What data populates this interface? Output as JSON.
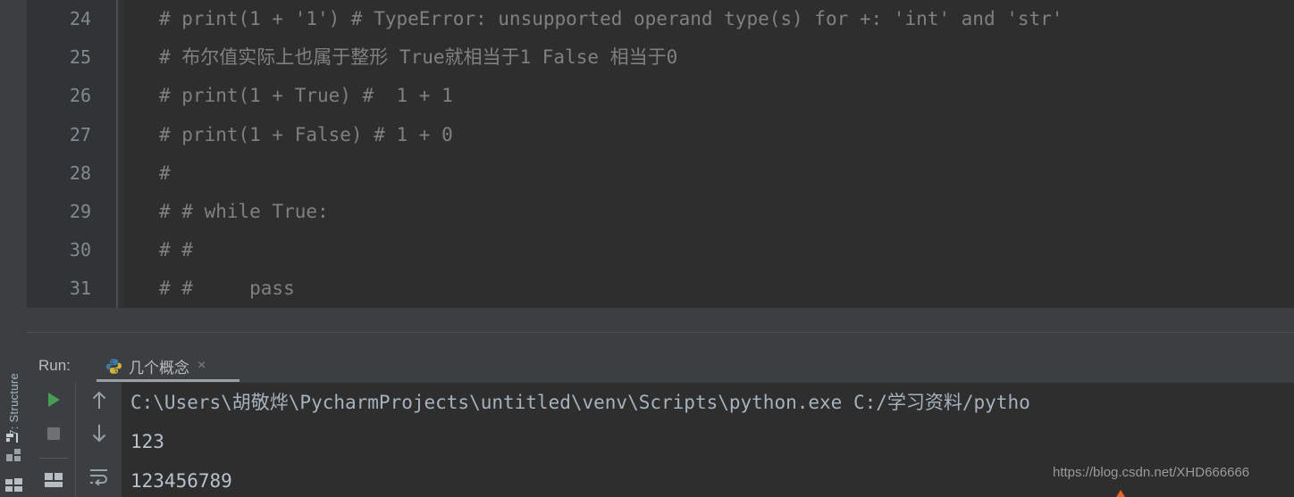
{
  "colors": {
    "editor_bg": "#2e2e2e",
    "gutter_bg": "#313335",
    "panel_bg": "#3c3f41",
    "comment_text": "#808080",
    "line_number": "#808b91",
    "console_text": "#b7c2cc",
    "run_green": "#499c54",
    "accent_underline": "#9ba0a4"
  },
  "tool_strip": {
    "structure_label_prefix": "7",
    "structure_label": "7: Structure",
    "icons": {
      "pin": "pin-icon",
      "structure": "structure-icon",
      "windows": "windows-icon"
    }
  },
  "editor": {
    "fold_marker": "fold-collapse-icon",
    "lines": [
      {
        "number": "24",
        "text": "# print(1 + '1') # TypeError: unsupported operand type(s) for +: 'int' and 'str'"
      },
      {
        "number": "25",
        "text": "# 布尔值实际上也属于整形 True就相当于1 False 相当于0"
      },
      {
        "number": "26",
        "text": "# print(1 + True) #  1 + 1"
      },
      {
        "number": "27",
        "text": "# print(1 + False) # 1 + 0"
      },
      {
        "number": "28",
        "text": "#"
      },
      {
        "number": "29",
        "text": "# # while True:"
      },
      {
        "number": "30",
        "text": "# #"
      },
      {
        "number": "31",
        "text": "# #     pass"
      }
    ]
  },
  "run_panel": {
    "label": "Run:",
    "tab": {
      "title": "几个概念",
      "close": "×",
      "icon": "python-icon"
    },
    "toolbar": {
      "run_button": "run-icon",
      "stop_button": "stop-icon",
      "layout_button": "layout-icon",
      "up_button": "arrow-up-icon",
      "down_button": "arrow-down-icon",
      "wrap_button": "soft-wrap-icon"
    },
    "console_lines": [
      {
        "kind": "cmd",
        "text": "C:\\Users\\胡敬烨\\PycharmProjects\\untitled\\venv\\Scripts\\python.exe C:/学习资料/pytho"
      },
      {
        "kind": "out",
        "text": "123"
      },
      {
        "kind": "out",
        "text": "123456789"
      }
    ]
  },
  "watermark": {
    "url": "https://blog.csdn.net/XHD666666"
  }
}
